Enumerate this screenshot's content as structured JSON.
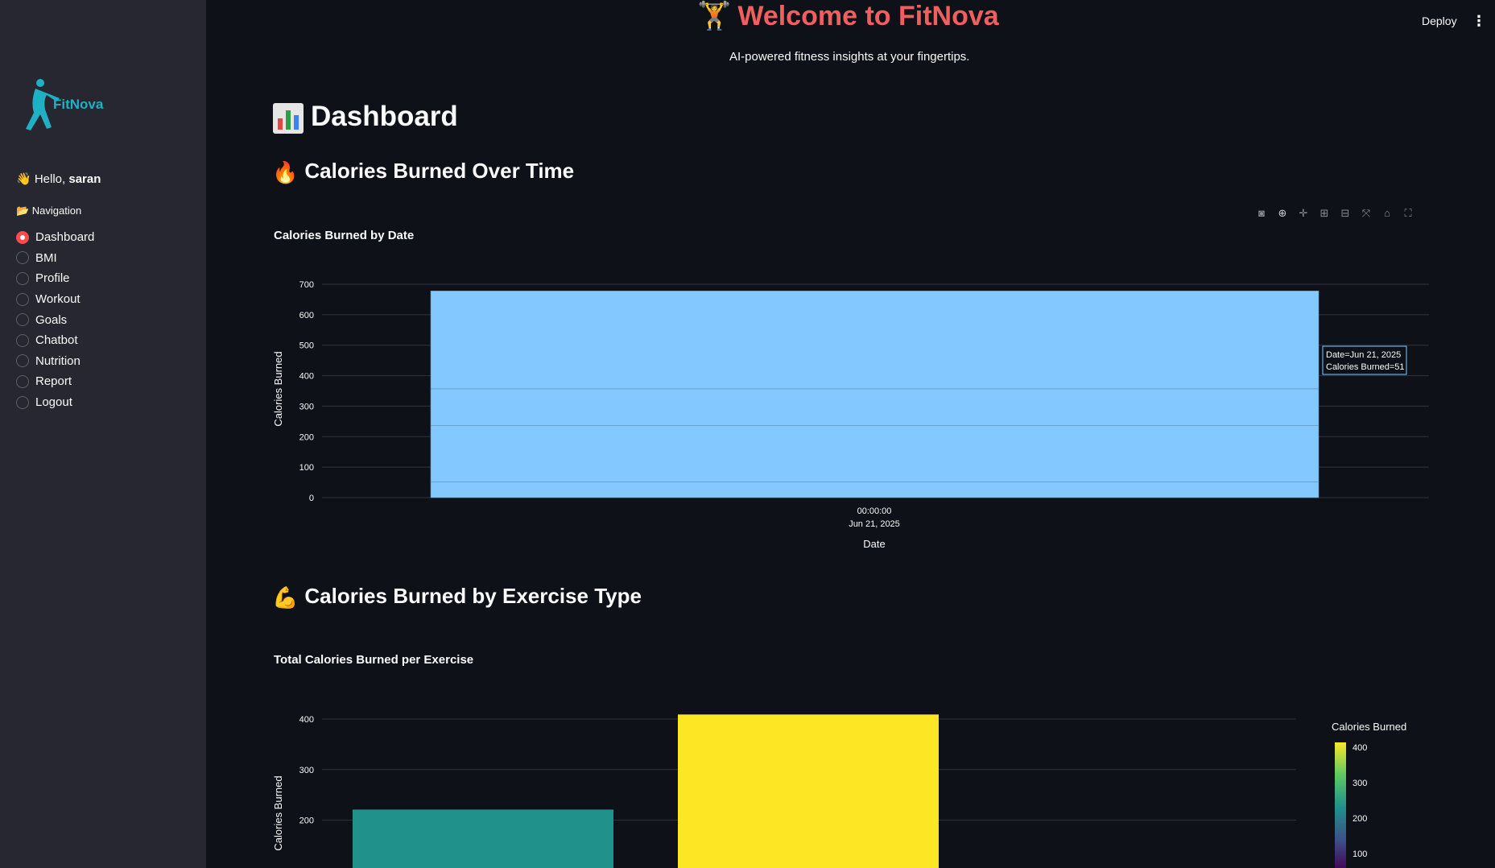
{
  "sidebar": {
    "logo_text": "FitNova",
    "greeting_prefix": "👋 Hello, ",
    "username": "saran",
    "nav_title": "📂 Navigation",
    "items": [
      {
        "label": "Dashboard",
        "selected": true
      },
      {
        "label": "BMI",
        "selected": false
      },
      {
        "label": "Profile",
        "selected": false
      },
      {
        "label": "Workout",
        "selected": false
      },
      {
        "label": "Goals",
        "selected": false
      },
      {
        "label": "Chatbot",
        "selected": false
      },
      {
        "label": "Nutrition",
        "selected": false
      },
      {
        "label": "Report",
        "selected": false
      },
      {
        "label": "Logout",
        "selected": false
      }
    ]
  },
  "header": {
    "deploy_label": "Deploy",
    "menu_icon": "more-vertical-icon"
  },
  "main": {
    "title_emoji": "🏋️",
    "title": "Welcome to FitNova",
    "tagline": "AI-powered fitness insights at your fingertips.",
    "dashboard_heading": "Dashboard",
    "section1_heading": "Calories Burned Over Time",
    "section2_heading": "Calories Burned by Exercise Type"
  },
  "toolbar": {
    "icons": [
      "camera-icon",
      "zoom-icon",
      "pan-icon",
      "zoom-in-icon",
      "zoom-out-icon",
      "autoscale-icon",
      "reset-axes-icon",
      "fullscreen-icon"
    ]
  },
  "colors": {
    "bar1": "#83c9ff",
    "accent": "#ff4b4b",
    "title": "#ef5f5f"
  },
  "chart_data": [
    {
      "type": "bar",
      "title": "Calories Burned by Date",
      "xlabel": "Date",
      "ylabel": "Calories Burned",
      "x_tick_line1": "00:00:00",
      "x_tick_line2": "Jun 21, 2025",
      "yticks": [
        0,
        100,
        200,
        300,
        400,
        500,
        600,
        700
      ],
      "ylim": [
        0,
        700
      ],
      "stack_values": [
        51,
        186,
        120,
        321
      ],
      "tooltip_line1": "Date=Jun 21, 2025",
      "tooltip_line2": "Calories Burned=51"
    },
    {
      "type": "bar",
      "title": "Total Calories Burned per Exercise",
      "ylabel": "Calories Burned",
      "yticks": [
        200,
        300,
        400
      ],
      "values": [
        221,
        409
      ],
      "colorbar_title": "Calories Burned",
      "colorbar_ticks": [
        400,
        300,
        200,
        100
      ]
    }
  ]
}
